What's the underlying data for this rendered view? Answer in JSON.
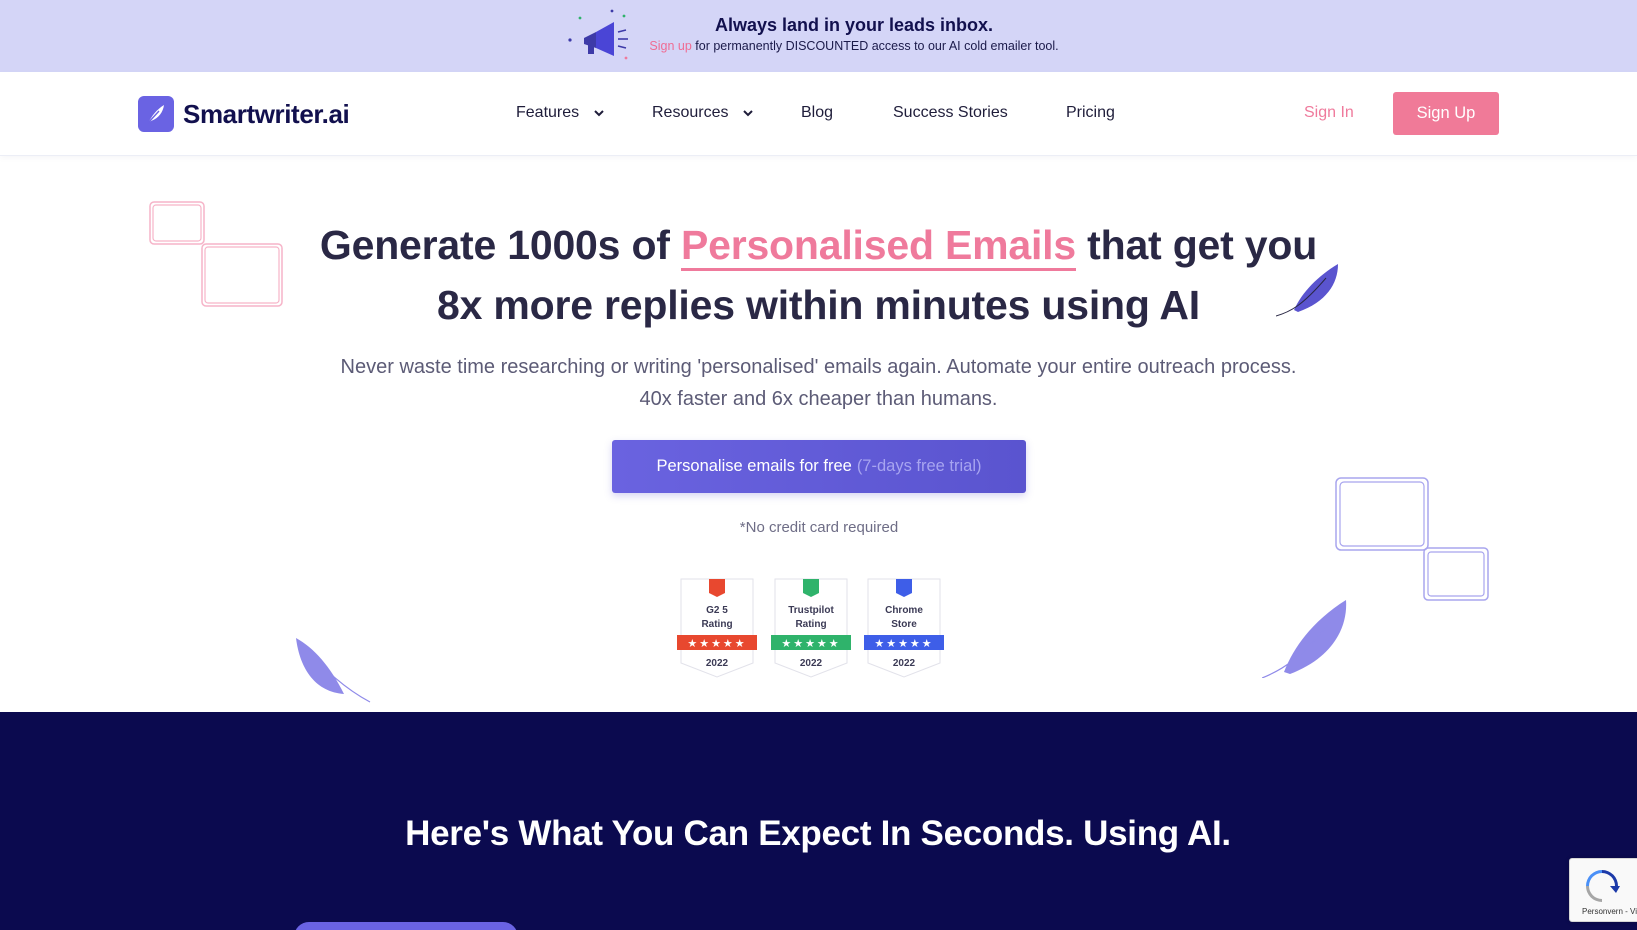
{
  "promo": {
    "title": "Always land in your leads inbox.",
    "link_text": "Sign up",
    "rest_text": " for permanently DISCOUNTED access to our AI cold emailer tool."
  },
  "header": {
    "logo_text": "Smartwriter.ai",
    "nav": [
      {
        "label": "Features",
        "has_dropdown": true
      },
      {
        "label": "Resources",
        "has_dropdown": true
      },
      {
        "label": "Blog",
        "has_dropdown": false
      },
      {
        "label": "Success Stories",
        "has_dropdown": false
      },
      {
        "label": "Pricing",
        "has_dropdown": false
      }
    ],
    "signin_label": "Sign In",
    "signup_label": "Sign Up"
  },
  "hero": {
    "title_part1": "Generate 1000s of ",
    "title_highlight": "Personalised Emails",
    "title_part2": " that get you 8x more replies within minutes using AI",
    "subtitle": "Never waste time researching or writing 'personalised' emails again. Automate your entire outreach process. 40x faster and 6x cheaper than humans.",
    "cta_label": "Personalise emails for free",
    "cta_muted": "(7-days free trial)",
    "note": "*No credit card required"
  },
  "badges": [
    {
      "title_line1": "G2 5",
      "title_line2": "Rating",
      "year": "2022",
      "stars": "★★★★★",
      "color": "#e8482f"
    },
    {
      "title_line1": "Trustpilot",
      "title_line2": "Rating",
      "year": "2022",
      "stars": "★★★★★",
      "color": "#2fb36b"
    },
    {
      "title_line1": "Chrome",
      "title_line2": "Store",
      "year": "2022",
      "stars": "★★★★★",
      "color": "#3e5ee8"
    }
  ],
  "section2": {
    "title": "Here's What You Can Expect In Seconds. Using AI."
  },
  "recaptcha": {
    "text": "Personvern - Vilkår"
  },
  "colors": {
    "brand_purple": "#6a63e3",
    "accent_pink": "#ef7a9c",
    "navy": "#0b0a4f",
    "promo_bg": "#d4d5f7"
  }
}
